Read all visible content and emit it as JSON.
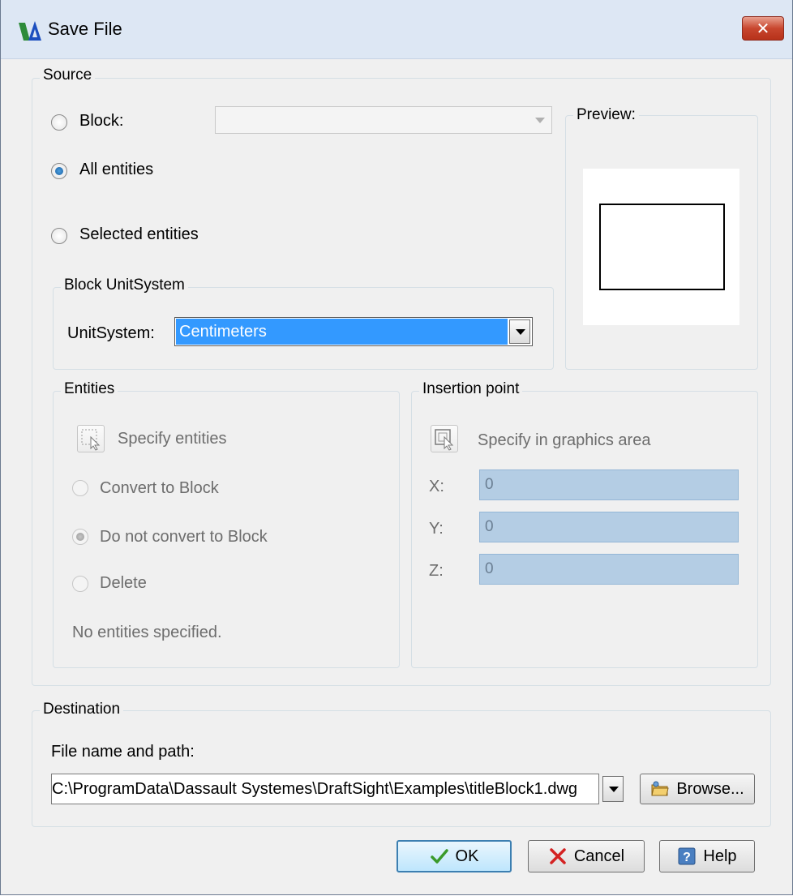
{
  "window": {
    "title": "Save File",
    "close_label": "✕"
  },
  "source": {
    "group_label": "Source",
    "block_label": "Block:",
    "block_value": "",
    "all_entities_label": "All entities",
    "selected_entities_label": "Selected entities",
    "selected_option": "All entities",
    "preview_label": "Preview:"
  },
  "block_unit_system": {
    "group_label": "Block UnitSystem",
    "unit_label": "UnitSystem:",
    "unit_value": "Centimeters"
  },
  "entities": {
    "group_label": "Entities",
    "specify_label": "Specify entities",
    "convert_label": "Convert to Block",
    "do_not_convert_label": "Do not convert to Block",
    "delete_label": "Delete",
    "status_text": "No entities specified.",
    "selected_option": "Do not convert to Block"
  },
  "insertion_point": {
    "group_label": "Insertion point",
    "specify_label": "Specify in graphics area",
    "x_label": "X:",
    "x_value": "0",
    "y_label": "Y:",
    "y_value": "0",
    "z_label": "Z:",
    "z_value": "0"
  },
  "destination": {
    "group_label": "Destination",
    "path_label": "File name and path:",
    "path_value": "C:\\ProgramData\\Dassault Systemes\\DraftSight\\Examples\\titleBlock1.dwg",
    "browse_label": "Browse..."
  },
  "buttons": {
    "ok": "OK",
    "cancel": "Cancel",
    "help": "Help"
  },
  "colors": {
    "titlebar": "#dde7f4",
    "selection": "#3399ff",
    "close": "#c8462e",
    "field_disabled": "#b4cde4"
  }
}
